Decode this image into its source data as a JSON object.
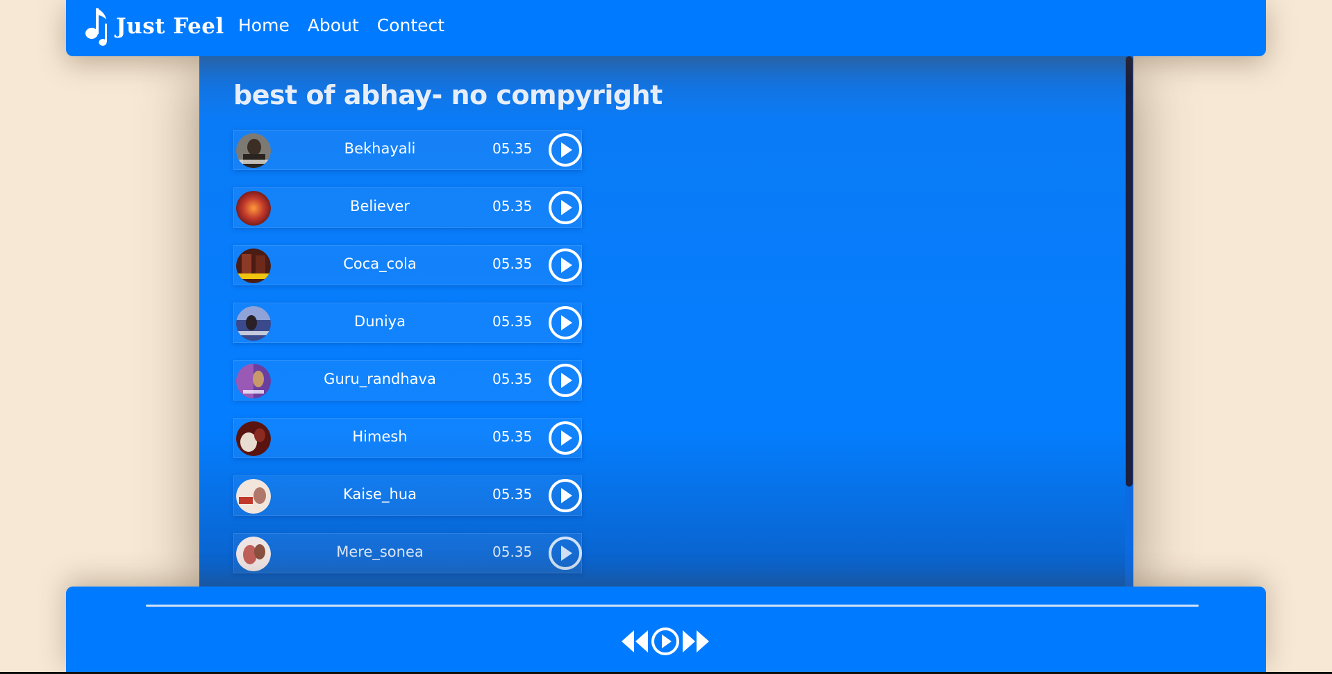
{
  "header": {
    "brand": "Just Feel",
    "nav": [
      {
        "label": "Home"
      },
      {
        "label": "About"
      },
      {
        "label": "Contect"
      }
    ]
  },
  "playlist": {
    "title": "best of abhay- no compyright",
    "songs": [
      {
        "name": "Bekhayali",
        "duration": "05.35"
      },
      {
        "name": "Believer",
        "duration": "05.35"
      },
      {
        "name": "Coca_cola",
        "duration": "05.35"
      },
      {
        "name": "Duniya",
        "duration": "05.35"
      },
      {
        "name": "Guru_randhava",
        "duration": "05.35"
      },
      {
        "name": "Himesh",
        "duration": "05.35"
      },
      {
        "name": "Kaise_hua",
        "duration": "05.35"
      },
      {
        "name": "Mere_sonea",
        "duration": "05.35"
      }
    ]
  },
  "player": {
    "progress": 0,
    "controls": [
      "backward-icon",
      "play-icon",
      "forward-icon"
    ]
  },
  "colors": {
    "accent": "#007bff",
    "background": "#f7e8d6"
  }
}
